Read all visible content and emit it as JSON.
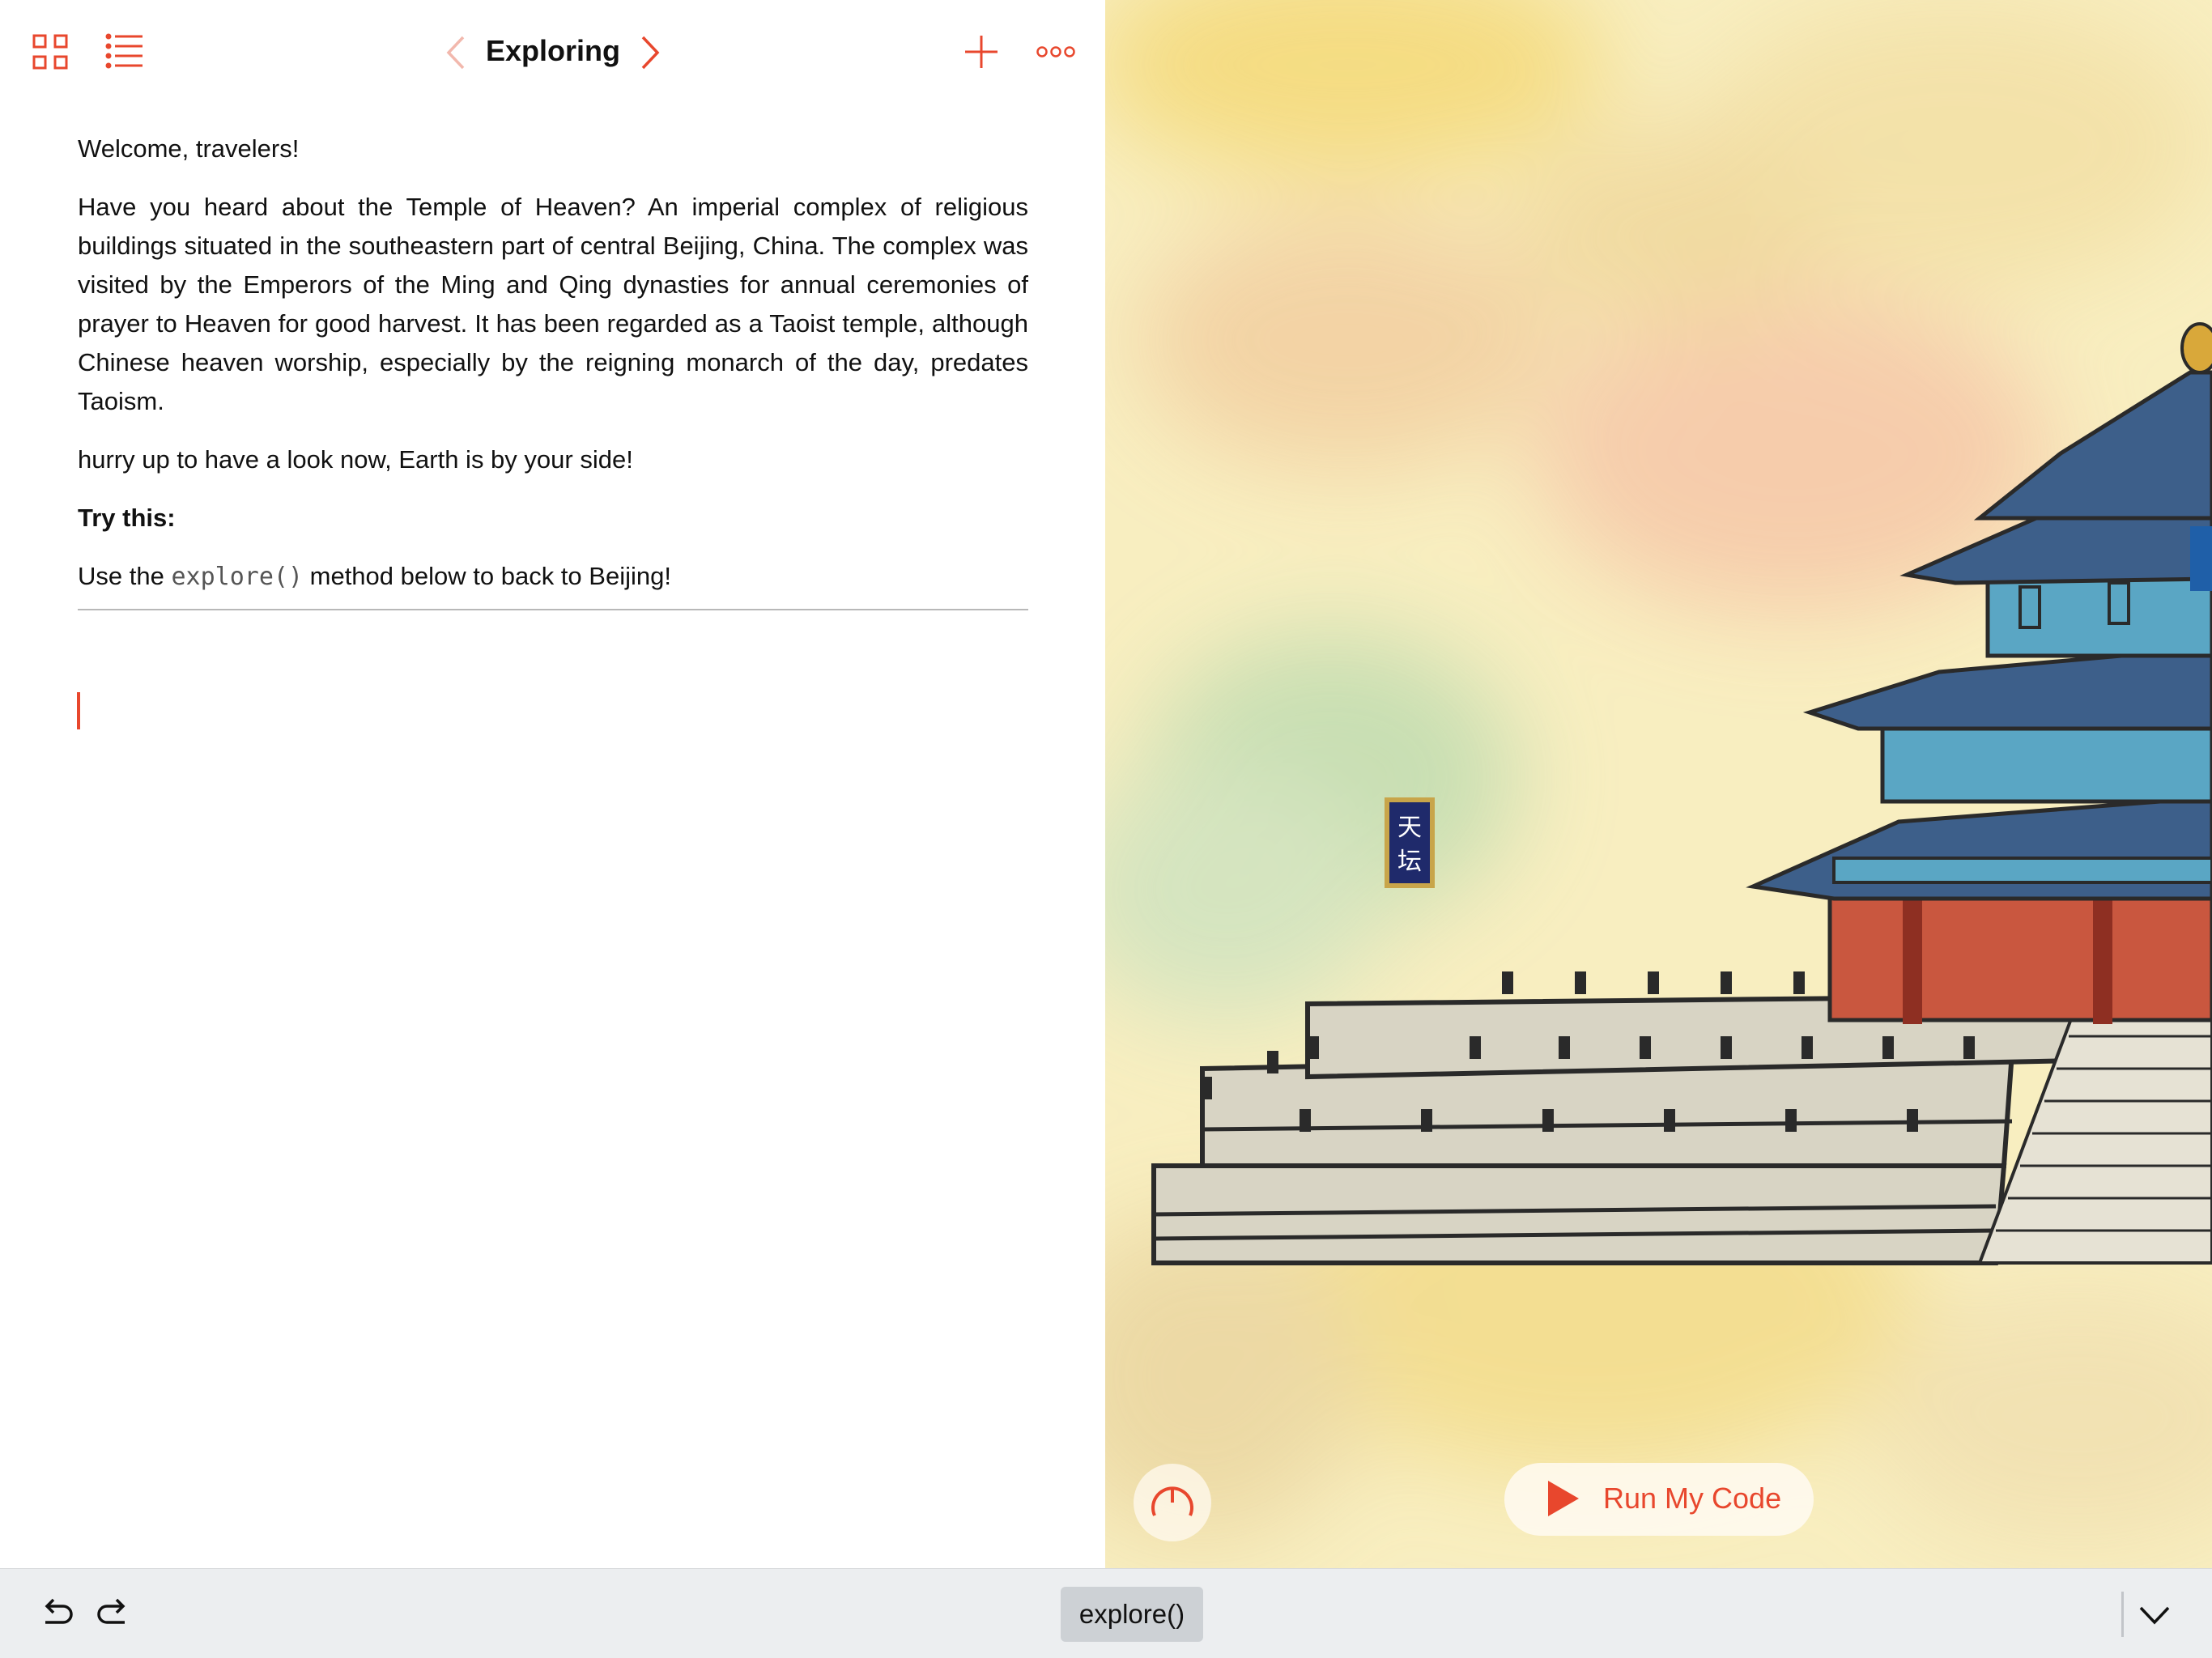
{
  "window": {
    "page_title": "Exploring"
  },
  "toolbar": {
    "icons": [
      "grid-icon",
      "list-icon",
      "chevron-left-icon",
      "chevron-right-icon",
      "plus-icon",
      "more-icon"
    ]
  },
  "content": {
    "greeting": "Welcome, travelers!",
    "intro": "Have you heard about the Temple of Heaven? An imperial complex of religious buildings situated in the southeastern part of central Beijing, China. The complex was visited by the Emperors of the Ming and Qing dynasties for annual ceremonies of prayer to Heaven for good harvest. It has been regarded as a Taoist temple, although Chinese heaven worship, especially by the reigning monarch of the day, predates Taoism.",
    "hurry": "hurry up to have a look now, Earth is by your side!",
    "try_label": "Try this:",
    "instruction_prefix": "Use the ",
    "instruction_code": "explore()",
    "instruction_suffix": " method below to back to Beijing!"
  },
  "live_view": {
    "plaque_text": "天坛",
    "run_label": "Run My Code",
    "speed_icon": "speedometer-icon"
  },
  "bottom_bar": {
    "suggestion": "explore()",
    "icons": [
      "undo-icon",
      "redo-icon",
      "chevron-down-icon"
    ]
  },
  "colors": {
    "accent": "#e8472d",
    "temple_roof": "#5aa6c4",
    "temple_wall": "#c9573f",
    "plaque": "#1f2a6b"
  }
}
